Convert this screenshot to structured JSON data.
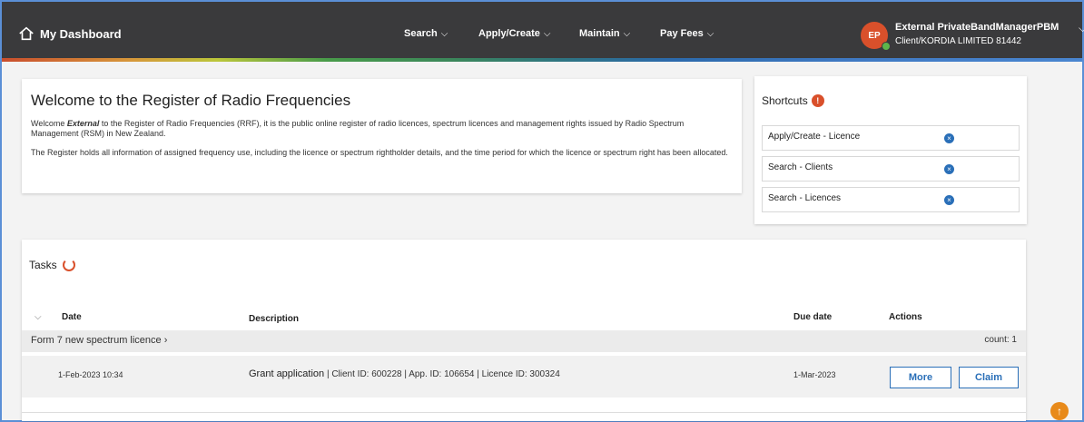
{
  "header": {
    "home_label": "My Dashboard",
    "nav": [
      {
        "label": "Search"
      },
      {
        "label": "Apply/Create"
      },
      {
        "label": "Maintain"
      },
      {
        "label": "Pay Fees"
      }
    ],
    "user_initials": "EP",
    "user_name": "External PrivateBandManagerPBM",
    "user_client": "Client/KORDIA LIMITED 81442"
  },
  "welcome": {
    "title": "Welcome to the Register of Radio Frequencies",
    "para1_prefix": "Welcome ",
    "para1_name": "External",
    "para1_rest": " to the Register of Radio Frequencies (RRF), it is the public online register of radio licences, spectrum licences and management rights issued by Radio Spectrum Management (RSM) in New Zealand.",
    "para2": "The Register holds all information of assigned frequency use, including the licence or spectrum rightholder details, and the time period for which the licence or spectrum right has been allocated."
  },
  "shortcuts": {
    "title": "Shortcuts",
    "badge": "!",
    "items": [
      {
        "label": "Apply/Create - Licence"
      },
      {
        "label": "Search - Clients"
      },
      {
        "label": "Search - Licences"
      }
    ]
  },
  "tasks": {
    "title": "Tasks",
    "columns": {
      "date": "Date",
      "description": "Description",
      "due": "Due date",
      "actions": "Actions"
    },
    "group": {
      "label": "Form 7 new spectrum licence",
      "count": "count: 1"
    },
    "rows": [
      {
        "date": "1-Feb-2023 10:34",
        "desc_title": "Grant application",
        "desc_rest": " | Client ID: 600228 | App. ID: 106654 | Licence ID: 300324",
        "due": "1-Mar-2023",
        "more_label": "More",
        "claim_label": "Claim"
      }
    ]
  },
  "colors": {
    "accent": "#2a6fb8",
    "brand_orange": "#d9502b",
    "topbar": "#3a3a3c"
  }
}
